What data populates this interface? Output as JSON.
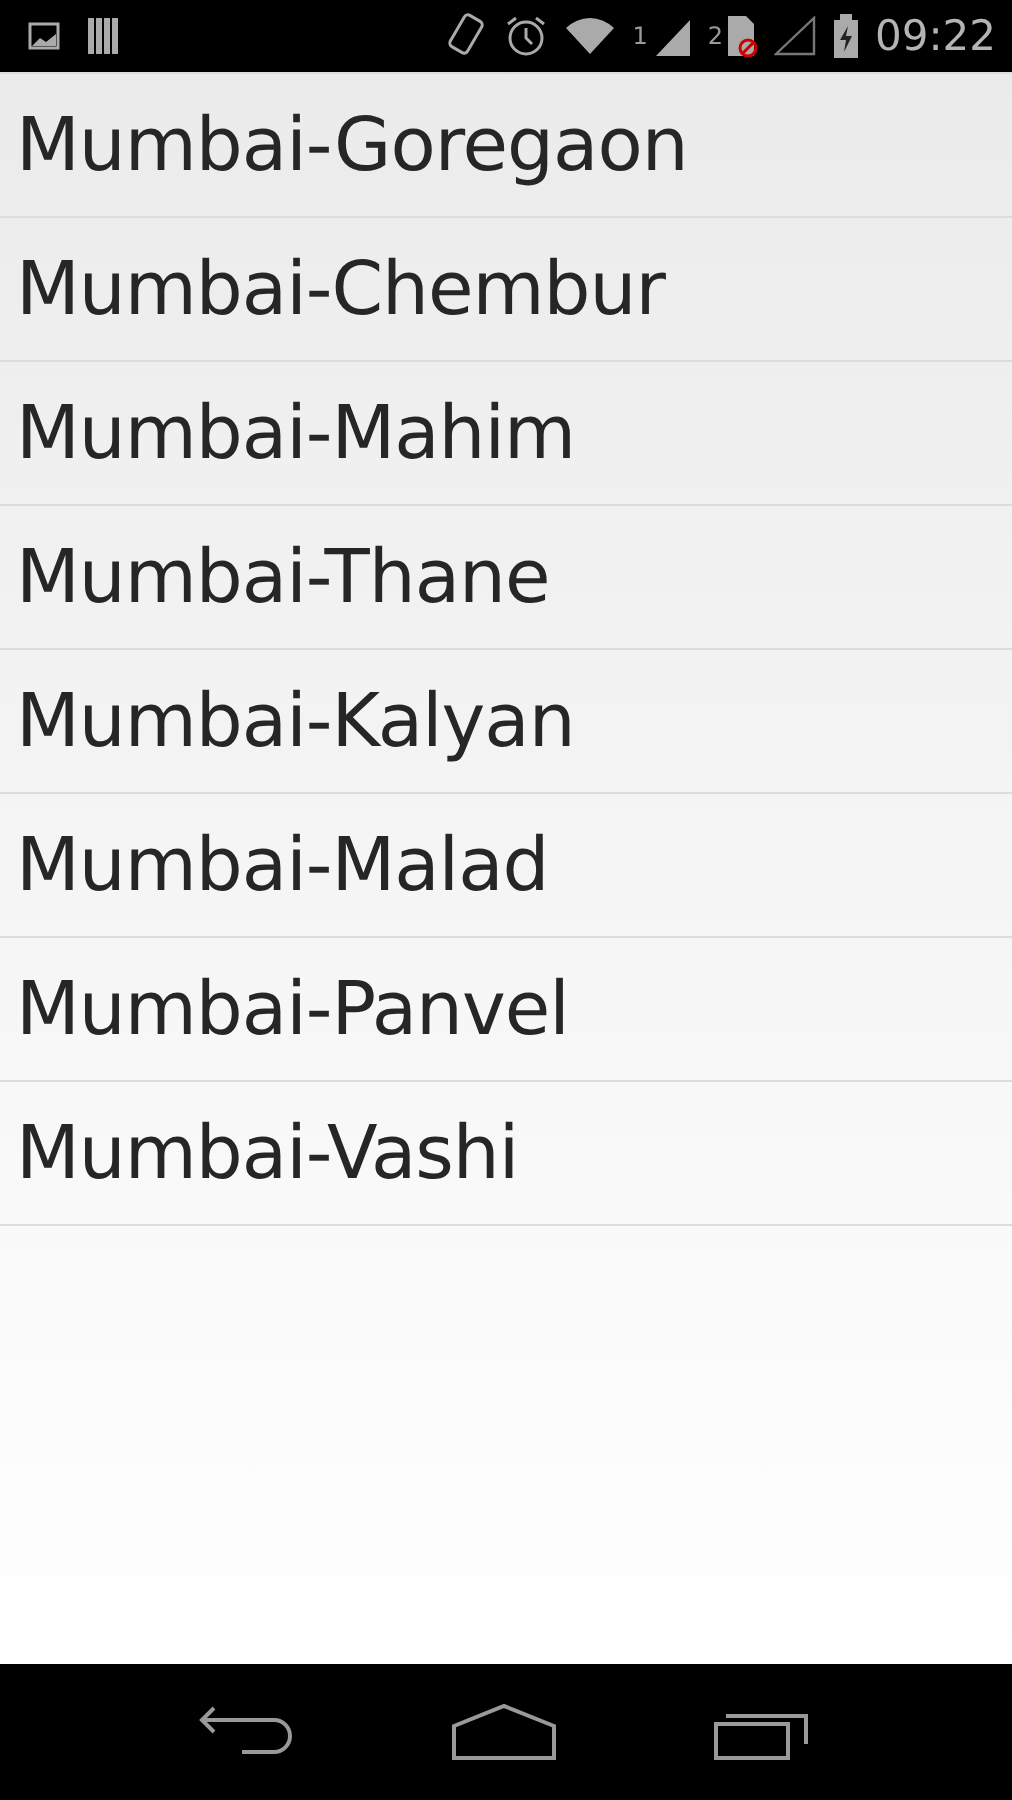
{
  "status_bar": {
    "sim_1_label": "1",
    "sim_2_label": "2",
    "time": "09:22"
  },
  "list": {
    "items": [
      {
        "label": "Mumbai-Goregaon"
      },
      {
        "label": "Mumbai-Chembur"
      },
      {
        "label": "Mumbai-Mahim"
      },
      {
        "label": "Mumbai-Thane"
      },
      {
        "label": "Mumbai-Kalyan"
      },
      {
        "label": "Mumbai-Malad"
      },
      {
        "label": "Mumbai-Panvel"
      },
      {
        "label": "Mumbai-Vashi"
      }
    ]
  }
}
